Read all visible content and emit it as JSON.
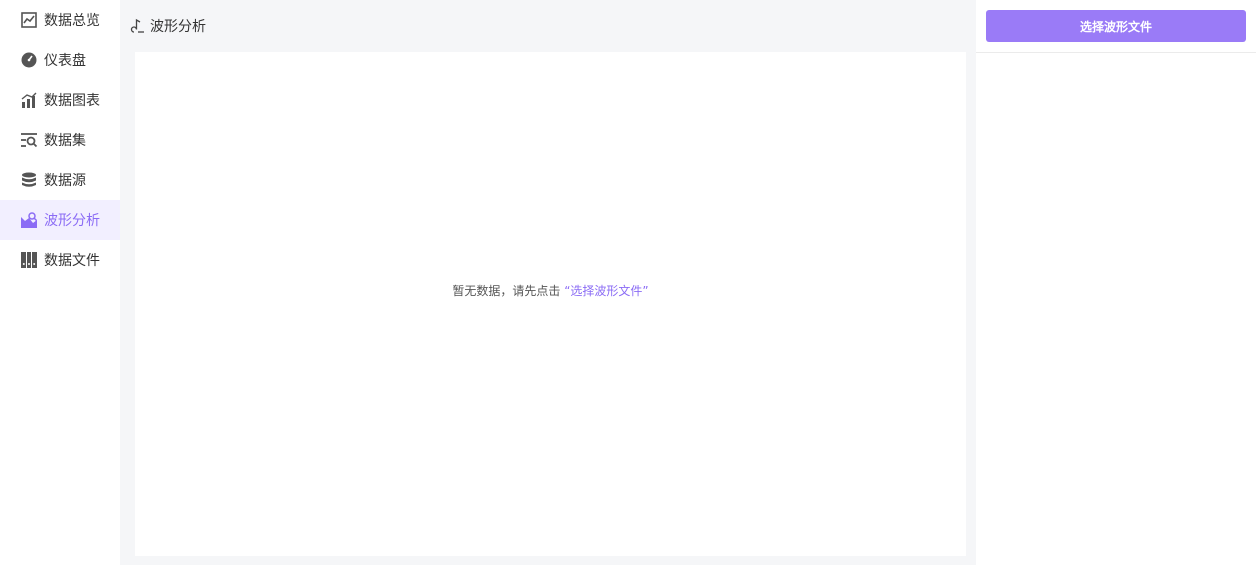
{
  "sidebar": {
    "items": [
      {
        "label": "数据总览",
        "icon": "overview-icon"
      },
      {
        "label": "仪表盘",
        "icon": "dashboard-icon"
      },
      {
        "label": "数据图表",
        "icon": "chart-icon"
      },
      {
        "label": "数据集",
        "icon": "dataset-icon"
      },
      {
        "label": "数据源",
        "icon": "database-icon"
      },
      {
        "label": "波形分析",
        "icon": "waveform-icon",
        "active": true
      },
      {
        "label": "数据文件",
        "icon": "data-file-icon"
      }
    ]
  },
  "header": {
    "title": "波形分析",
    "icon": "waveform-header-icon"
  },
  "panel": {
    "empty_prefix": "暂无数据，请先点击 ",
    "empty_link": "“选择波形文件”"
  },
  "right_panel": {
    "select_button_label": "选择波形文件"
  },
  "colors": {
    "accent": "#8b6cf5",
    "button": "#9a7bf7",
    "active_bg": "#f2efff",
    "main_bg": "#f5f6f8"
  }
}
